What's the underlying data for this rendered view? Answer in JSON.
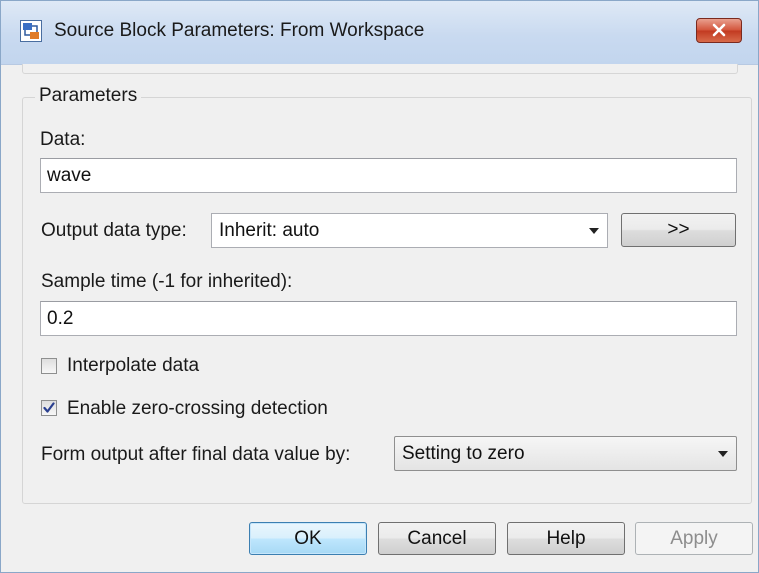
{
  "window": {
    "title": "Source Block Parameters: From Workspace"
  },
  "parameters": {
    "group_title": "Parameters",
    "data_label": "Data:",
    "data_value": "wave",
    "output_type_label": "Output data type:",
    "output_type_value": "Inherit: auto",
    "assistant_button": ">>",
    "sample_time_label": "Sample time (-1 for inherited):",
    "sample_time_value": "0.2",
    "interpolate_label": "Interpolate data",
    "interpolate_checked": false,
    "zero_crossing_label": "Enable zero-crossing detection",
    "zero_crossing_checked": true,
    "form_output_label": "Form output after final data value by:",
    "form_output_value": "Setting to zero"
  },
  "buttons": {
    "ok": "OK",
    "cancel": "Cancel",
    "help": "Help",
    "apply": "Apply"
  },
  "icons": {
    "app": "simulink-block-icon",
    "close": "close-icon",
    "dropdown": "chevron-down-icon",
    "check": "check-icon"
  },
  "colors": {
    "titlebar": "#c9daf0",
    "close_button": "#c23a21",
    "default_button": "#bee6fd"
  }
}
